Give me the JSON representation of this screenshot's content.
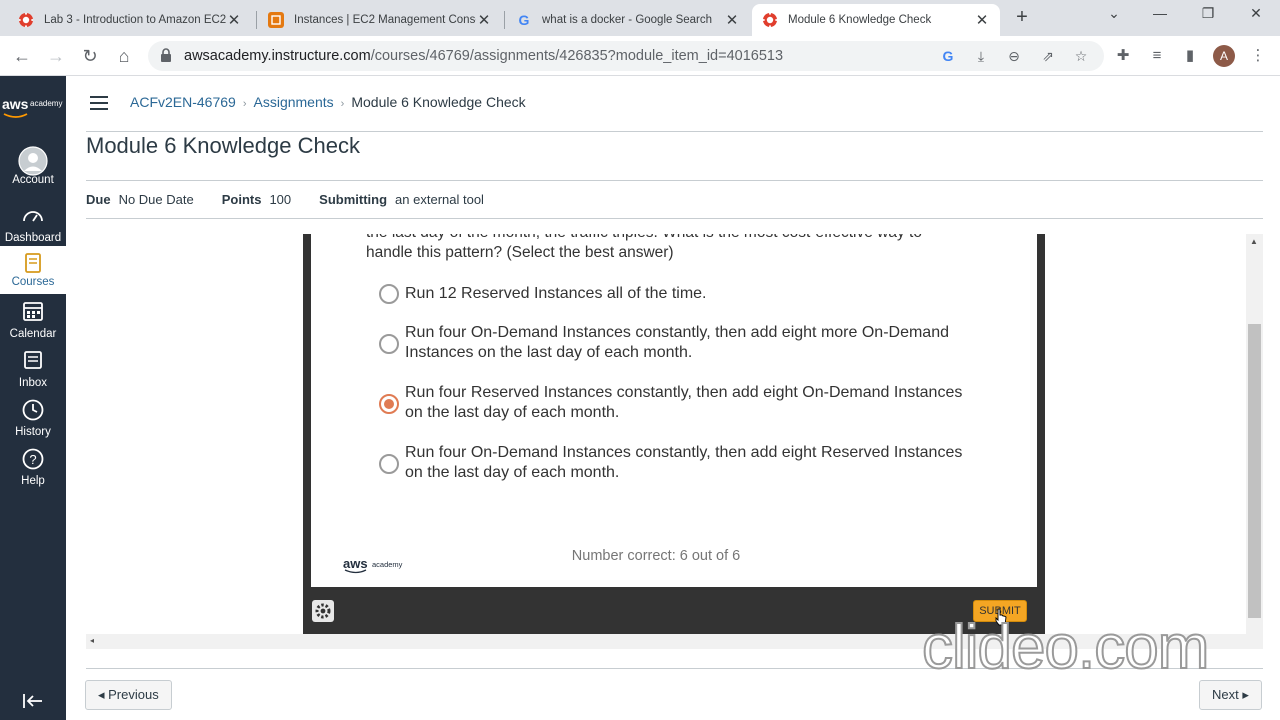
{
  "browser": {
    "tabs": [
      {
        "title": "Lab 3 - Introduction to Amazon EC2",
        "favicon": "canvas-icon",
        "active": false
      },
      {
        "title": "Instances | EC2 Management Console",
        "favicon": "aws-icon",
        "active": false
      },
      {
        "title": "what is a docker - Google Search",
        "favicon": "google-icon",
        "active": false
      },
      {
        "title": "Module 6 Knowledge Check",
        "favicon": "canvas-icon",
        "active": true
      }
    ],
    "url_host": "awsacademy.instructure.com",
    "url_path": "/courses/46769/assignments/426835?module_item_id=4016513",
    "profile_initial": "A"
  },
  "sidebar": {
    "logo_text": "aws",
    "logo_sub": "academy",
    "items": [
      {
        "label": "Account",
        "icon": "account-icon"
      },
      {
        "label": "Dashboard",
        "icon": "dashboard-icon"
      },
      {
        "label": "Courses",
        "icon": "courses-icon",
        "active": true
      },
      {
        "label": "Calendar",
        "icon": "calendar-icon"
      },
      {
        "label": "Inbox",
        "icon": "inbox-icon"
      },
      {
        "label": "History",
        "icon": "history-icon"
      },
      {
        "label": "Help",
        "icon": "help-icon"
      }
    ]
  },
  "breadcrumb": {
    "course": "ACFv2EN-46769",
    "section": "Assignments",
    "current": "Module 6 Knowledge Check"
  },
  "assignment": {
    "title": "Module 6 Knowledge Check",
    "due_label": "Due",
    "due_value": "No Due Date",
    "points_label": "Points",
    "points_value": "100",
    "submitting_label": "Submitting",
    "submitting_value": "an external tool"
  },
  "quiz": {
    "question_partial": "the last day of the month, the traffic triples. What is the most cost-effective way to",
    "question_line2": "handle this pattern? (Select the best answer)",
    "options": [
      {
        "line1": "Run 12 Reserved Instances all of the time.",
        "line2": "",
        "selected": false
      },
      {
        "line1": "Run four On-Demand Instances constantly, then add eight more On-Demand",
        "line2": "Instances on the last day of each month.",
        "selected": false
      },
      {
        "line1": "Run four Reserved Instances constantly, then add eight On-Demand Instances",
        "line2": "on the last day of each month.",
        "selected": true
      },
      {
        "line1": "Run four On-Demand Instances constantly, then add eight Reserved Instances",
        "line2": "on the last day of each month.",
        "selected": false
      }
    ],
    "footer_logo": "aws",
    "footer_logo_sub": "academy",
    "score_text": "Number correct: 6 out of 6",
    "submit_label": "SUBMIT"
  },
  "footer": {
    "previous_label": "◂ Previous",
    "next_label": "Next ▸"
  },
  "watermark": "clideo.com",
  "colors": {
    "sidebar_bg": "#232f3e",
    "link": "#2b6896",
    "selected_radio": "#e07b53",
    "submit_bg": "#f5a623"
  }
}
